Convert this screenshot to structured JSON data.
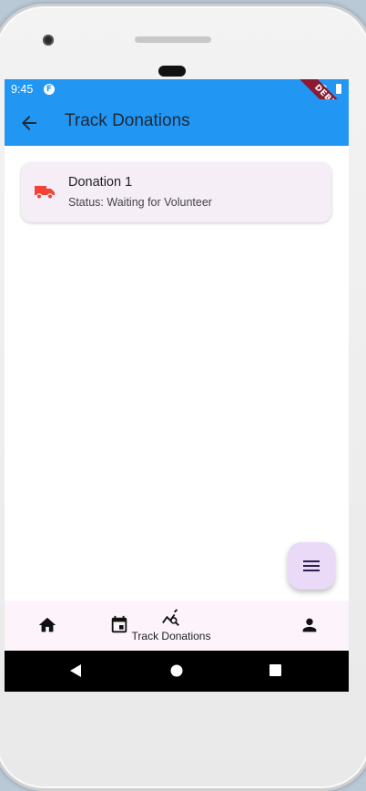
{
  "status_bar": {
    "time": "9:45",
    "app_badge": "F",
    "debug_banner": "DEBUG"
  },
  "app_bar": {
    "title": "Track Donations",
    "back_icon": "arrow-back-icon"
  },
  "donations": [
    {
      "title": "Donation 1",
      "status": "Status: Waiting for Volunteer",
      "icon": "truck-icon",
      "icon_color": "#f44336"
    }
  ],
  "fab": {
    "icon": "menu-icon"
  },
  "bottom_nav": {
    "items": [
      {
        "icon": "home-icon",
        "label": ""
      },
      {
        "icon": "calendar-icon",
        "label": ""
      },
      {
        "icon": "track-search-icon",
        "label": "Track Donations",
        "active": true
      },
      {
        "icon": "person-icon",
        "label": ""
      }
    ]
  },
  "colors": {
    "primary": "#2196f3",
    "card_bg": "#f5eef7",
    "fab_bg": "#ead9f7",
    "nav_bg": "#fdf3fb"
  }
}
